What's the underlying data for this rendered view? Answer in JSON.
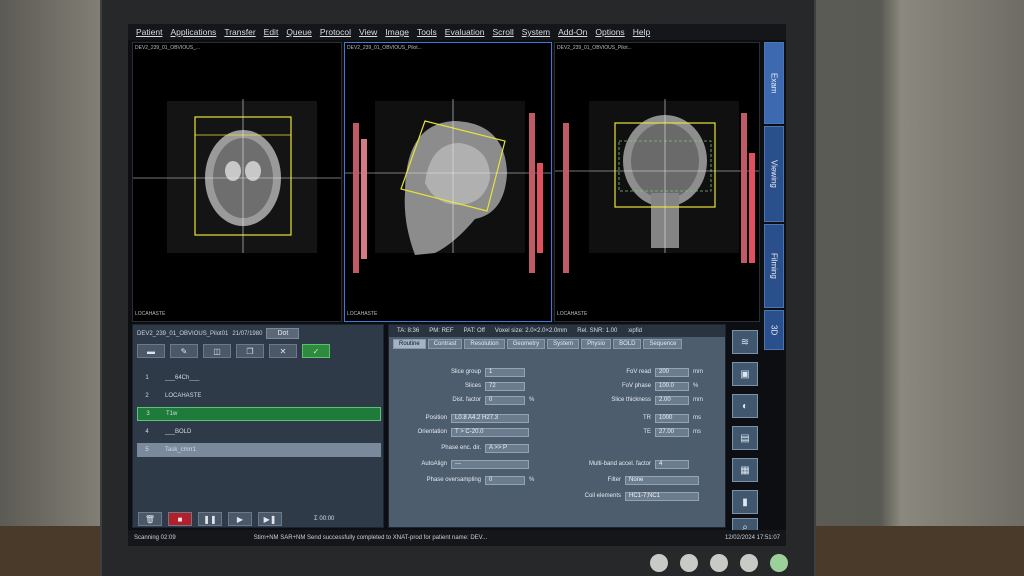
{
  "menubar": [
    "Patient",
    "Applications",
    "Transfer",
    "Edit",
    "Queue",
    "Protocol",
    "View",
    "Image",
    "Tools",
    "Evaluation",
    "Scroll",
    "System",
    "Add-On",
    "Options",
    "Help"
  ],
  "viewers": {
    "left": {
      "top_info": "DEV2_239_01_OBVIOUS_...",
      "bottom_info": "LOCAHASTE",
      "side_label": "A"
    },
    "middle": {
      "top_info": "DEV2_239_01_OBVIOUS_Pilot...",
      "bottom_info": "LOCAHASTE"
    },
    "right": {
      "top_info": "DEV2_239_01_OBVIOUS_Pilot...",
      "bottom_info": "LOCAHASTE"
    }
  },
  "sidetabs": [
    "Exam",
    "Viewing",
    "Filming",
    "3D"
  ],
  "list": {
    "patient_bar": "DEV2_239_01_OBVIOUS_Pilot01",
    "date": "21/07/1980",
    "dot_button": "Dot",
    "rows": [
      {
        "num": "1",
        "name": "___64Ch___"
      },
      {
        "num": "2",
        "name": "LOCAHASTE"
      },
      {
        "num": "3",
        "name": "T1w"
      },
      {
        "num": "4",
        "name": "___BOLD"
      },
      {
        "num": "5",
        "name": "Task_cmrr1"
      }
    ],
    "timer": "Σ 00:00"
  },
  "params": {
    "ta": "TA: 8:36",
    "pm": "PM: REF",
    "pat": "PAT: Off",
    "voxel": "Voxel size: 2.0×2.0×2.0mm",
    "snr": "Rel. SNR: 1.00",
    "mode": ":epfid",
    "tabs": [
      "Routine",
      "Contrast",
      "Resolution",
      "Geometry",
      "System",
      "Physio",
      "BOLD",
      "Sequence"
    ],
    "slice_group_label": "Slice group",
    "slice_group": "1",
    "slices_label": "Slices",
    "slices": "72",
    "dist_label": "Dist. factor",
    "dist": "0",
    "dist_unit": "%",
    "position_label": "Position",
    "position": "L0.8 A4.2 H27.3",
    "orientation_label": "Orientation",
    "orientation": "T > C-20.0",
    "phase_dir_label": "Phase enc. dir.",
    "phase_dir": "A >> P",
    "autoalign_label": "AutoAlign",
    "autoalign": "---",
    "phase_os_label": "Phase oversampling",
    "phase_os": "0",
    "phase_os_unit": "%",
    "fov_read_label": "FoV read",
    "fov_read": "200",
    "fov_read_unit": "mm",
    "fov_phase_label": "FoV phase",
    "fov_phase": "100.0",
    "fov_phase_unit": "%",
    "thickness_label": "Slice thickness",
    "thickness": "2.00",
    "thickness_unit": "mm",
    "tr_label": "TR",
    "tr": "1000",
    "tr_unit": "ms",
    "te_label": "TE",
    "te": "27.00",
    "te_unit": "ms",
    "multiband_label": "Multi-band accel. factor",
    "multiband": "4",
    "filter_label": "Filter",
    "filter": "None",
    "coil_label": "Coil elements",
    "coil": "HC1-7;NC1"
  },
  "status": {
    "left": "Scanning 02:09",
    "message": "Stim+NM SAR+NM Send successfully completed to XNAT-prod for patient name: DEV...",
    "datetime": "12/02/2024 17:51:07"
  },
  "colors": {
    "accent": "#3d69b0",
    "selected_row": "#1f7b3a",
    "record": "#b4202a",
    "planning_box": "#e8e23a"
  }
}
